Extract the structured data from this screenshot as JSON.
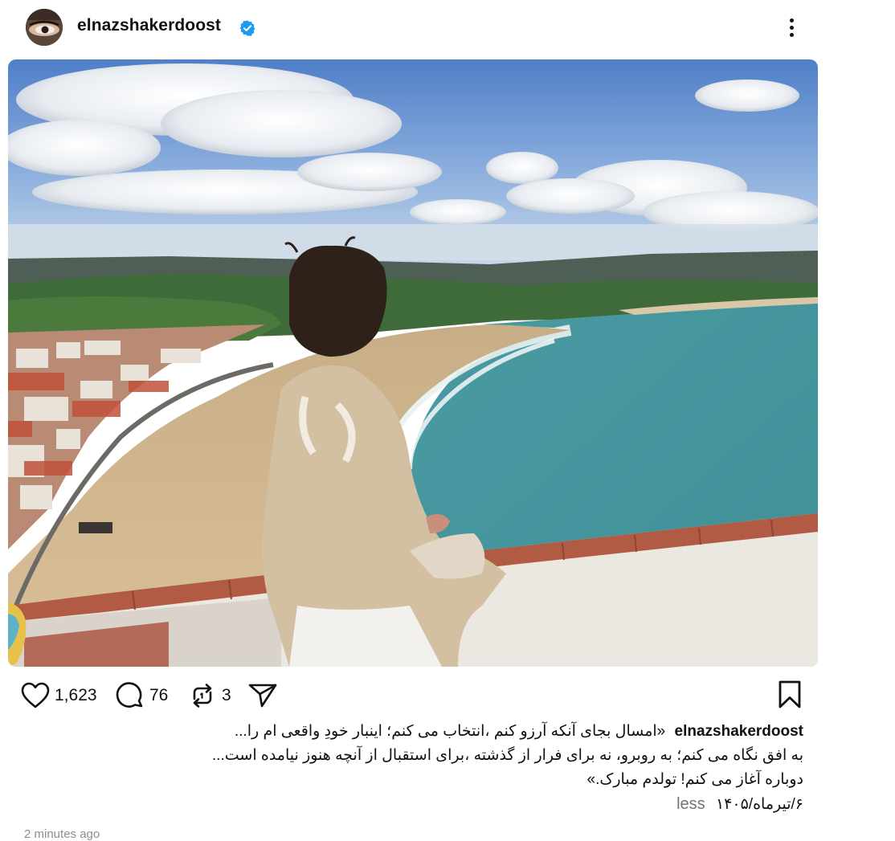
{
  "post": {
    "username": "elnazshakerdoost",
    "verified": true,
    "more_icon": "more-vertical-icon",
    "likes": "1,623",
    "comments": "76",
    "reposts": "3",
    "caption_username": "elnazshakerdoost",
    "caption_lines": [
      "«امسال بجای آنکه آرزو کنم ،انتخاب می کنم؛ اینبار خودِ واقعی ام را...",
      "به افق نگاه می کنم؛ به روبرو، نه برای فرار از گذشته ،برای استقبال از آنچه هنوز نیامده است...",
      "دوباره آغاز می کنم! تولدم مبارک.»"
    ],
    "date": "۶/تیرماه/۱۴۰۵",
    "less_label": "less",
    "timestamp": "2 minutes ago"
  },
  "icons": {
    "like": "heart-icon",
    "comment": "comment-icon",
    "repost": "repost-icon",
    "share": "send-icon",
    "save": "bookmark-icon"
  },
  "colors": {
    "verified_badge": "#1d9bf0",
    "muted_text": "#737373"
  }
}
